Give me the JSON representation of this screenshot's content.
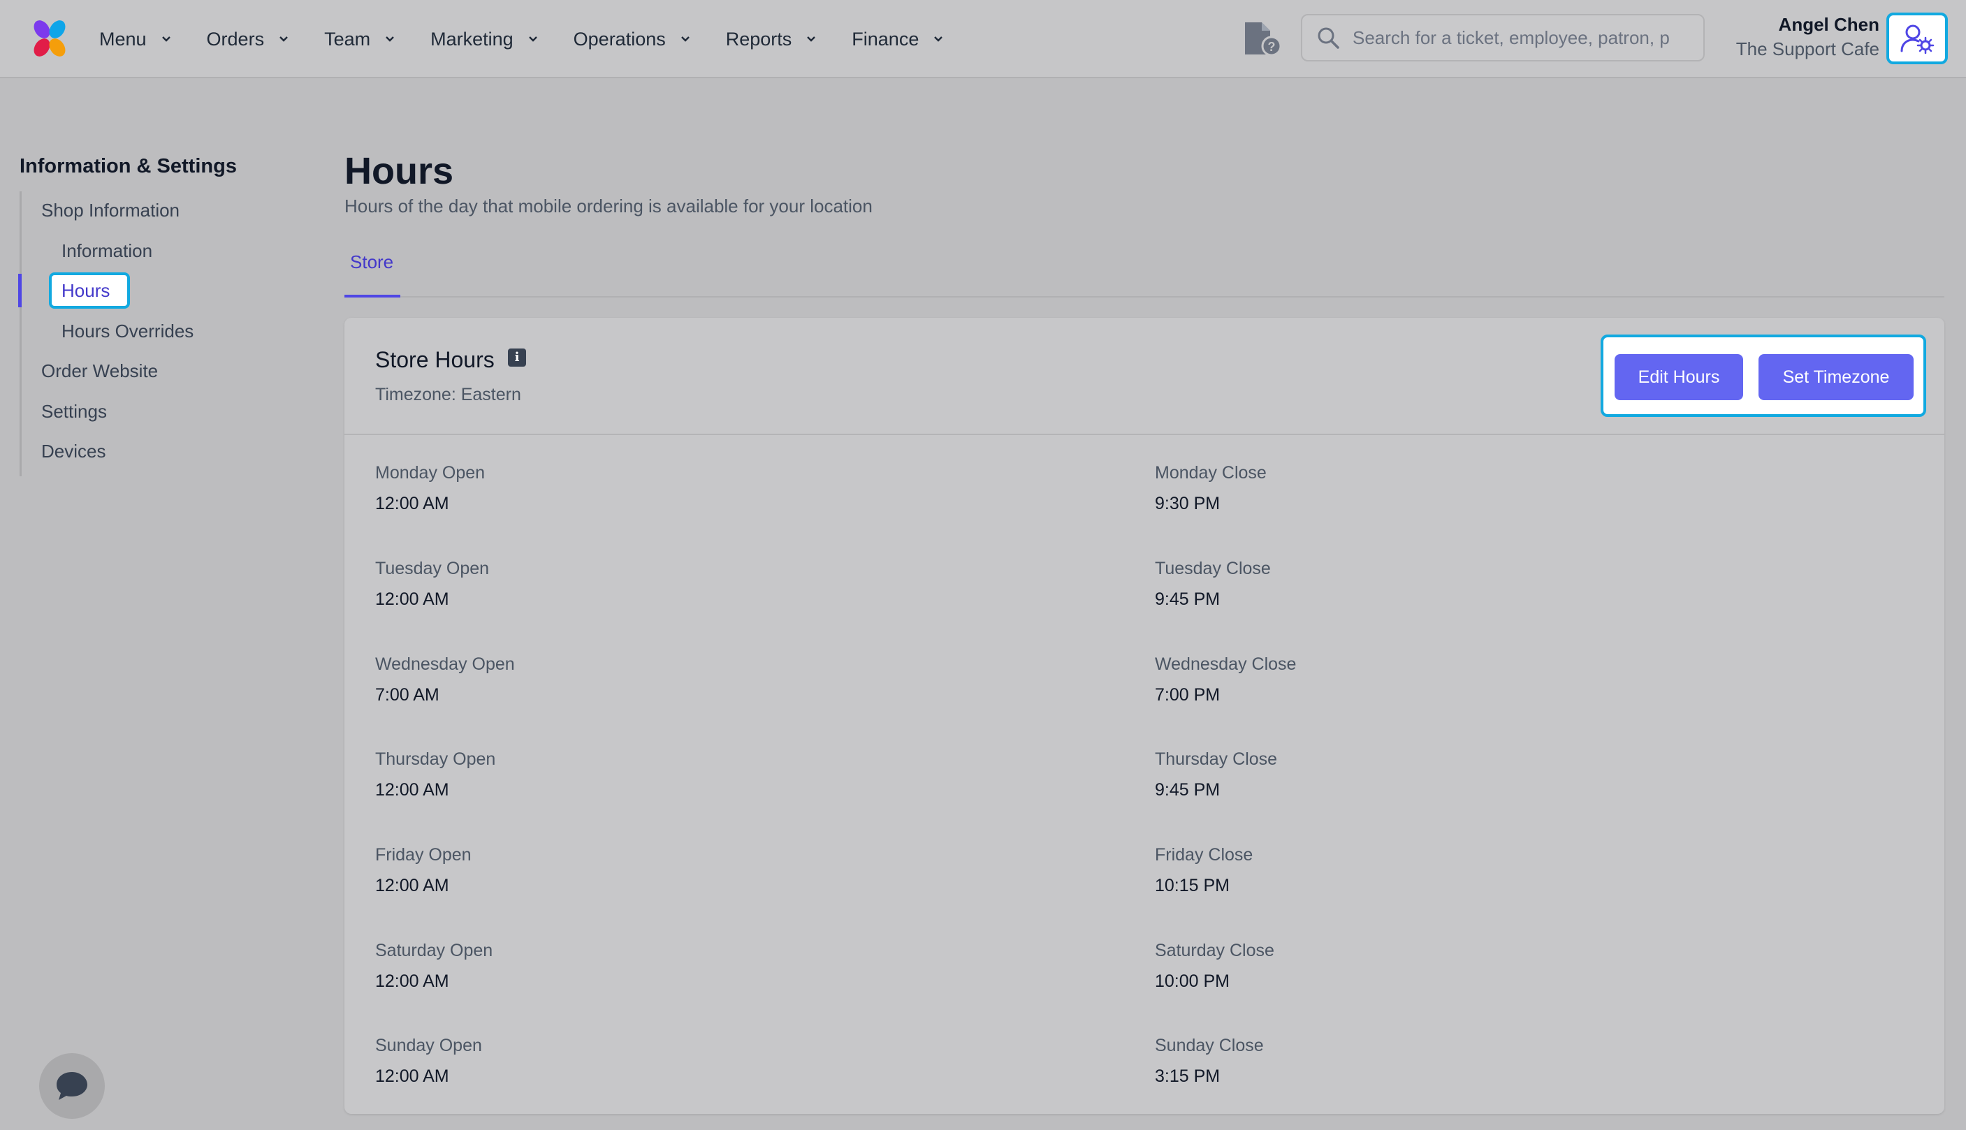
{
  "nav": {
    "items": [
      {
        "label": "Menu"
      },
      {
        "label": "Orders"
      },
      {
        "label": "Team"
      },
      {
        "label": "Marketing"
      },
      {
        "label": "Operations"
      },
      {
        "label": "Reports"
      },
      {
        "label": "Finance"
      }
    ],
    "search_placeholder": "Search for a ticket, employee, patron, p",
    "user": {
      "name": "Angel Chen",
      "org": "The Support Cafe"
    }
  },
  "sidebar": {
    "title": "Information & Settings",
    "items": [
      {
        "label": "Shop Information"
      },
      {
        "label": "Information"
      },
      {
        "label": "Hours"
      },
      {
        "label": "Hours Overrides"
      },
      {
        "label": "Order Website"
      },
      {
        "label": "Settings"
      },
      {
        "label": "Devices"
      }
    ]
  },
  "page": {
    "title": "Hours",
    "subtitle": "Hours of the day that mobile ordering is available for your location",
    "tabs": [
      {
        "label": "Store"
      }
    ]
  },
  "card": {
    "title": "Store Hours",
    "timezone": "Timezone: Eastern",
    "edit_label": "Edit Hours",
    "timezone_label": "Set Timezone",
    "days": [
      {
        "open_label": "Monday Open",
        "open": "12:00 AM",
        "close_label": "Monday Close",
        "close": "9:30 PM"
      },
      {
        "open_label": "Tuesday Open",
        "open": "12:00 AM",
        "close_label": "Tuesday Close",
        "close": "9:45 PM"
      },
      {
        "open_label": "Wednesday Open",
        "open": "7:00 AM",
        "close_label": "Wednesday Close",
        "close": "7:00 PM"
      },
      {
        "open_label": "Thursday Open",
        "open": "12:00 AM",
        "close_label": "Thursday Close",
        "close": "9:45 PM"
      },
      {
        "open_label": "Friday Open",
        "open": "12:00 AM",
        "close_label": "Friday Close",
        "close": "10:15 PM"
      },
      {
        "open_label": "Saturday Open",
        "open": "12:00 AM",
        "close_label": "Saturday Close",
        "close": "10:00 PM"
      },
      {
        "open_label": "Sunday Open",
        "open": "12:00 AM",
        "close_label": "Sunday Close",
        "close": "3:15 PM"
      }
    ]
  },
  "colors": {
    "accent": "#6366f1",
    "highlight": "#12a9e0",
    "active_text": "#4338ca"
  },
  "icons": {
    "logo": "pinwheel-logo",
    "help": "document-question-icon",
    "search": "search-icon",
    "user_settings": "user-gear-icon",
    "chat": "chat-bubble-icon",
    "info": "info-icon"
  }
}
